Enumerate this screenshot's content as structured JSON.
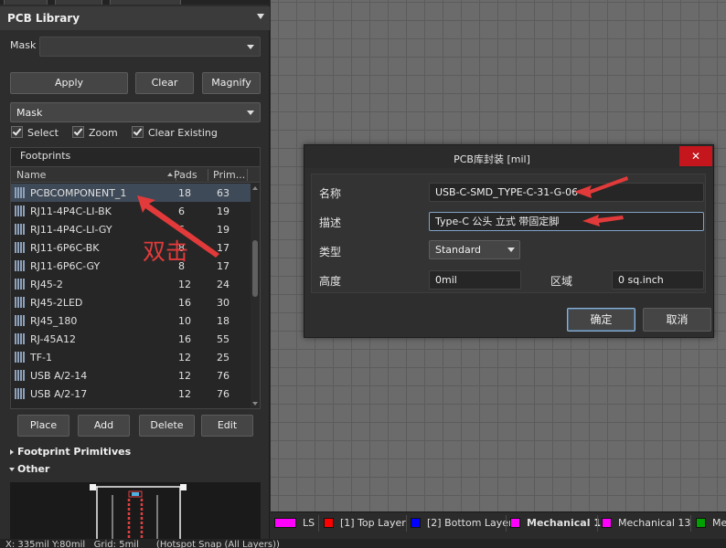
{
  "panel": {
    "title": "PCB Library",
    "mask_label": "Mask",
    "mask_value": "",
    "buttons": {
      "apply": "Apply",
      "clear": "Clear",
      "magnify": "Magnify"
    },
    "mask_mode": "Mask",
    "checkboxes": [
      {
        "label": "Select",
        "checked": true
      },
      {
        "label": "Zoom",
        "checked": true
      },
      {
        "label": "Clear Existing",
        "checked": true
      }
    ],
    "footprints": {
      "title": "Footprints",
      "columns": {
        "name": "Name",
        "pads": "Pads",
        "primitives": "Prim..."
      },
      "rows": [
        {
          "name": "PCBCOMPONENT_1",
          "pads": "18",
          "primitives": "63",
          "selected": true
        },
        {
          "name": "RJ11-4P4C-LI-BK",
          "pads": "6",
          "primitives": "19"
        },
        {
          "name": "RJ11-4P4C-LI-GY",
          "pads": "6",
          "primitives": "19"
        },
        {
          "name": "RJ11-6P6C-BK",
          "pads": "8",
          "primitives": "17"
        },
        {
          "name": "RJ11-6P6C-GY",
          "pads": "8",
          "primitives": "17"
        },
        {
          "name": "RJ45-2",
          "pads": "12",
          "primitives": "24"
        },
        {
          "name": "RJ45-2LED",
          "pads": "16",
          "primitives": "30"
        },
        {
          "name": "RJ45_180",
          "pads": "10",
          "primitives": "18"
        },
        {
          "name": "RJ-45A12",
          "pads": "16",
          "primitives": "55"
        },
        {
          "name": "TF-1",
          "pads": "12",
          "primitives": "25"
        },
        {
          "name": "USB A/2-14",
          "pads": "12",
          "primitives": "76"
        },
        {
          "name": "USB A/2-17",
          "pads": "12",
          "primitives": "76"
        }
      ]
    },
    "actions": {
      "place": "Place",
      "add": "Add",
      "delete": "Delete",
      "edit": "Edit"
    },
    "sections": {
      "footprint_primitives": "Footprint Primitives",
      "other": "Other"
    }
  },
  "dialog": {
    "title": "PCB库封装 [mil]",
    "close_glyph": "✕",
    "labels": {
      "name": "名称",
      "description": "描述",
      "type": "类型",
      "height": "高度",
      "area": "区域"
    },
    "values": {
      "name": "USB-C-SMD_TYPE-C-31-G-06",
      "description": "Type-C 公头 立式 带固定脚",
      "type": "Standard",
      "height": "0mil",
      "area": "0 sq.inch"
    },
    "buttons": {
      "ok": "确定",
      "cancel": "取消"
    }
  },
  "annotation": {
    "double_click": "双击"
  },
  "layers": [
    {
      "name": "LS",
      "color": "#ff00ff",
      "active": false
    },
    {
      "name": "[1] Top Layer",
      "color": "#ff0000"
    },
    {
      "name": "[2] Bottom Layer",
      "color": "#0000ff"
    },
    {
      "name": "Mechanical 1",
      "color": "#ff00ff",
      "active": true
    },
    {
      "name": "Mechanical 13",
      "color": "#ff00ff"
    },
    {
      "name": "Me",
      "color": "#00a000"
    }
  ],
  "status": {
    "text": "X: 335mil Y:80mil   Grid: 5mil      (Hotspot Snap (All Layers))"
  },
  "colors": {
    "accent_red": "#e23a3a",
    "selection": "#3f4a58",
    "close_red": "#c4161c"
  }
}
